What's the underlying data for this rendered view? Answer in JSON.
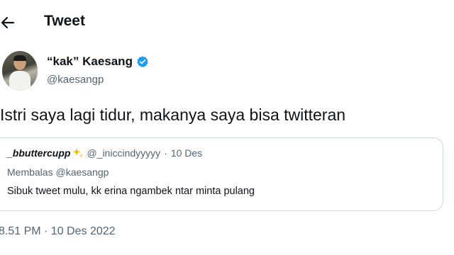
{
  "header": {
    "back_icon": "arrow-left-icon",
    "title": "Tweet"
  },
  "author": {
    "display_name": "“kak” Kaesang",
    "handle": "@kaesangp",
    "verified": true,
    "verified_icon": "verified-badge-icon",
    "verified_color": "#1d9bf0"
  },
  "tweet": {
    "text": "Istri saya lagi tidur, makanya saya bisa twitteran",
    "timestamp": "8.51 PM · 10 Des 2022"
  },
  "quoted": {
    "name": "_bbuttercupp",
    "emoji_icon": "sparkles-icon",
    "handle": "@_iniccindyyyyy",
    "separator": "·",
    "date": "10 Des",
    "reply_prefix": "Membalas",
    "reply_to": "@kaesangp",
    "text": "Sibuk tweet mulu, kk erina ngambek ntar minta pulang"
  },
  "colors": {
    "text_primary": "#0f1419",
    "text_secondary": "#536471",
    "border": "#cfd9de",
    "accent": "#1d9bf0"
  }
}
